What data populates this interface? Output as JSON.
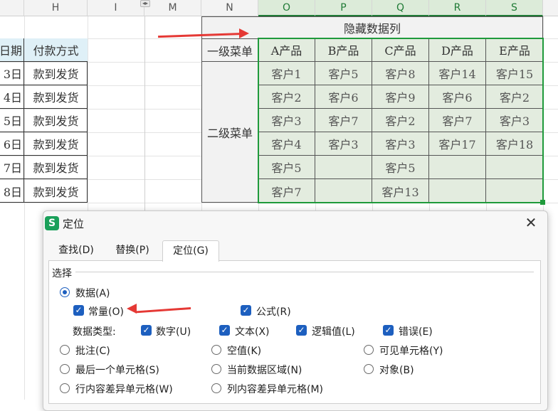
{
  "columns": [
    "H",
    "I",
    "M",
    "N",
    "O",
    "P",
    "Q",
    "R",
    "S"
  ],
  "left_table": {
    "headers": [
      "日期",
      "付款方式"
    ],
    "rows": [
      [
        "3日",
        "款到发货"
      ],
      [
        "4日",
        "款到发货"
      ],
      [
        "5日",
        "款到发货"
      ],
      [
        "6日",
        "款到发货"
      ],
      [
        "7日",
        "款到发货"
      ],
      [
        "8日",
        "款到发货"
      ]
    ]
  },
  "right_table": {
    "title": "隐藏数据列",
    "row_label_1": "一级菜单",
    "row_label_2": "二级菜单",
    "products": [
      "A产品",
      "B产品",
      "C产品",
      "D产品",
      "E产品"
    ],
    "customers": [
      [
        "客户1",
        "客户5",
        "客户8",
        "客户14",
        "客户15"
      ],
      [
        "客户2",
        "客户6",
        "客户9",
        "客户6",
        "客户2"
      ],
      [
        "客户3",
        "客户7",
        "客户2",
        "客户7",
        "客户3"
      ],
      [
        "客户4",
        "客户3",
        "客户3",
        "客户17",
        "客户18"
      ],
      [
        "客户5",
        "",
        "客户5",
        "",
        ""
      ],
      [
        "客户7",
        "",
        "客户13",
        "",
        ""
      ]
    ]
  },
  "dialog": {
    "title": "定位",
    "logo": "S",
    "close": "✕",
    "tabs": [
      "查找(D)",
      "替换(P)",
      "定位(G)"
    ],
    "active_tab": "定位(G)",
    "section": "选择",
    "data_radio": "数据(A)",
    "constant": "常量(O)",
    "formula": "公式(R)",
    "data_type_label": "数据类型:",
    "data_types": [
      "数字(U)",
      "文本(X)",
      "逻辑值(L)",
      "错误(E)"
    ],
    "options": [
      [
        "批注(C)",
        "空值(K)",
        "可见单元格(Y)"
      ],
      [
        "最后一个单元格(S)",
        "当前数据区域(N)",
        "对象(B)"
      ],
      [
        "行内容差异单元格(W)",
        "列内容差异单元格(M)"
      ]
    ],
    "checked_icon": "check-icon"
  },
  "colors": {
    "accent": "#1f7a35",
    "highlight": "#e3ecdf",
    "arrow": "#e53935",
    "checkbox": "#1d5fbf"
  }
}
